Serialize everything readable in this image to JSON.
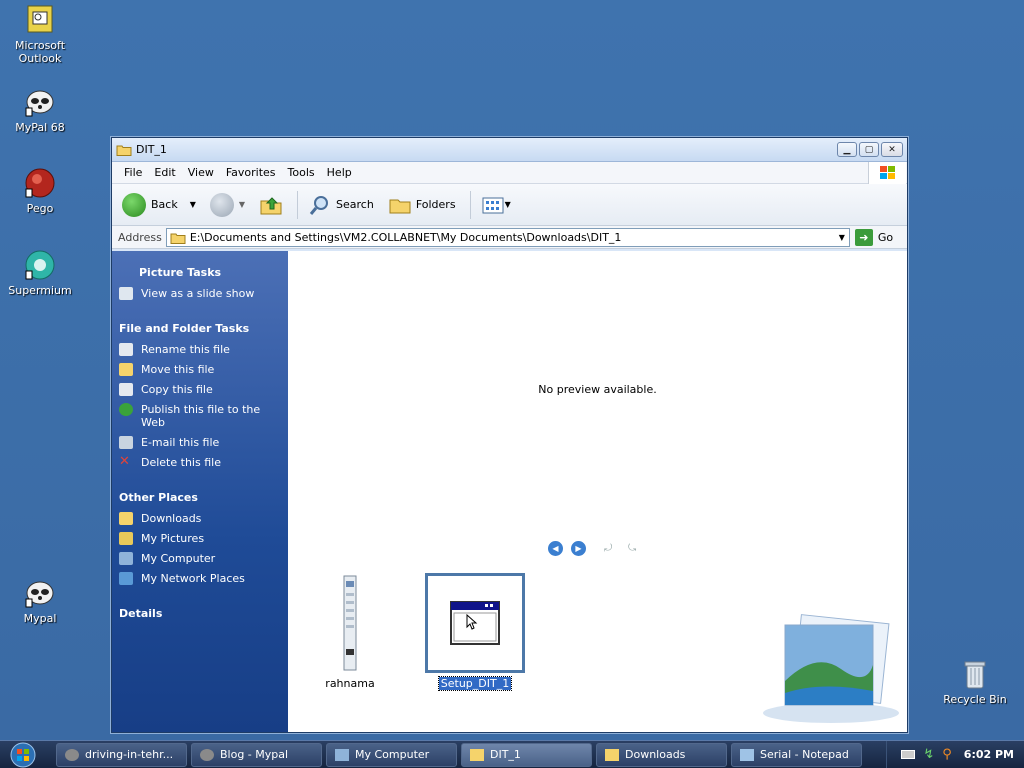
{
  "desktop": {
    "icons": [
      {
        "label": "Microsoft Outlook"
      },
      {
        "label": "MyPal 68"
      },
      {
        "label": "Pego"
      },
      {
        "label": "Supermium"
      },
      {
        "label": "Mypal"
      },
      {
        "label": "Recycle Bin"
      }
    ]
  },
  "window": {
    "title": "DIT_1",
    "menu": [
      "File",
      "Edit",
      "View",
      "Favorites",
      "Tools",
      "Help"
    ],
    "toolbar": {
      "back": "Back",
      "search": "Search",
      "folders": "Folders"
    },
    "address": {
      "label": "Address",
      "path": "E:\\Documents and Settings\\VM2.COLLABNET\\My Documents\\Downloads\\DIT_1",
      "go": "Go"
    },
    "taskpane": {
      "picture_tasks": {
        "title": "Picture Tasks",
        "items": [
          "View as a slide show"
        ]
      },
      "file_tasks": {
        "title": "File and Folder Tasks",
        "items": [
          "Rename this file",
          "Move this file",
          "Copy this file",
          "Publish this file to the Web",
          "E-mail this file",
          "Delete this file"
        ]
      },
      "other_places": {
        "title": "Other Places",
        "items": [
          "Downloads",
          "My Pictures",
          "My Computer",
          "My Network Places"
        ]
      },
      "details": {
        "title": "Details"
      }
    },
    "preview": {
      "message": "No preview available."
    },
    "files": [
      {
        "name": "rahnama",
        "selected": false
      },
      {
        "name": "Setup_DIT_1",
        "selected": true
      }
    ]
  },
  "taskbar": {
    "items": [
      {
        "label": "driving-in-tehr..."
      },
      {
        "label": "Blog - Mypal"
      },
      {
        "label": "My Computer"
      },
      {
        "label": "DIT_1",
        "active": true
      },
      {
        "label": "Downloads"
      },
      {
        "label": "Serial - Notepad"
      }
    ],
    "clock": "6:02 PM"
  }
}
